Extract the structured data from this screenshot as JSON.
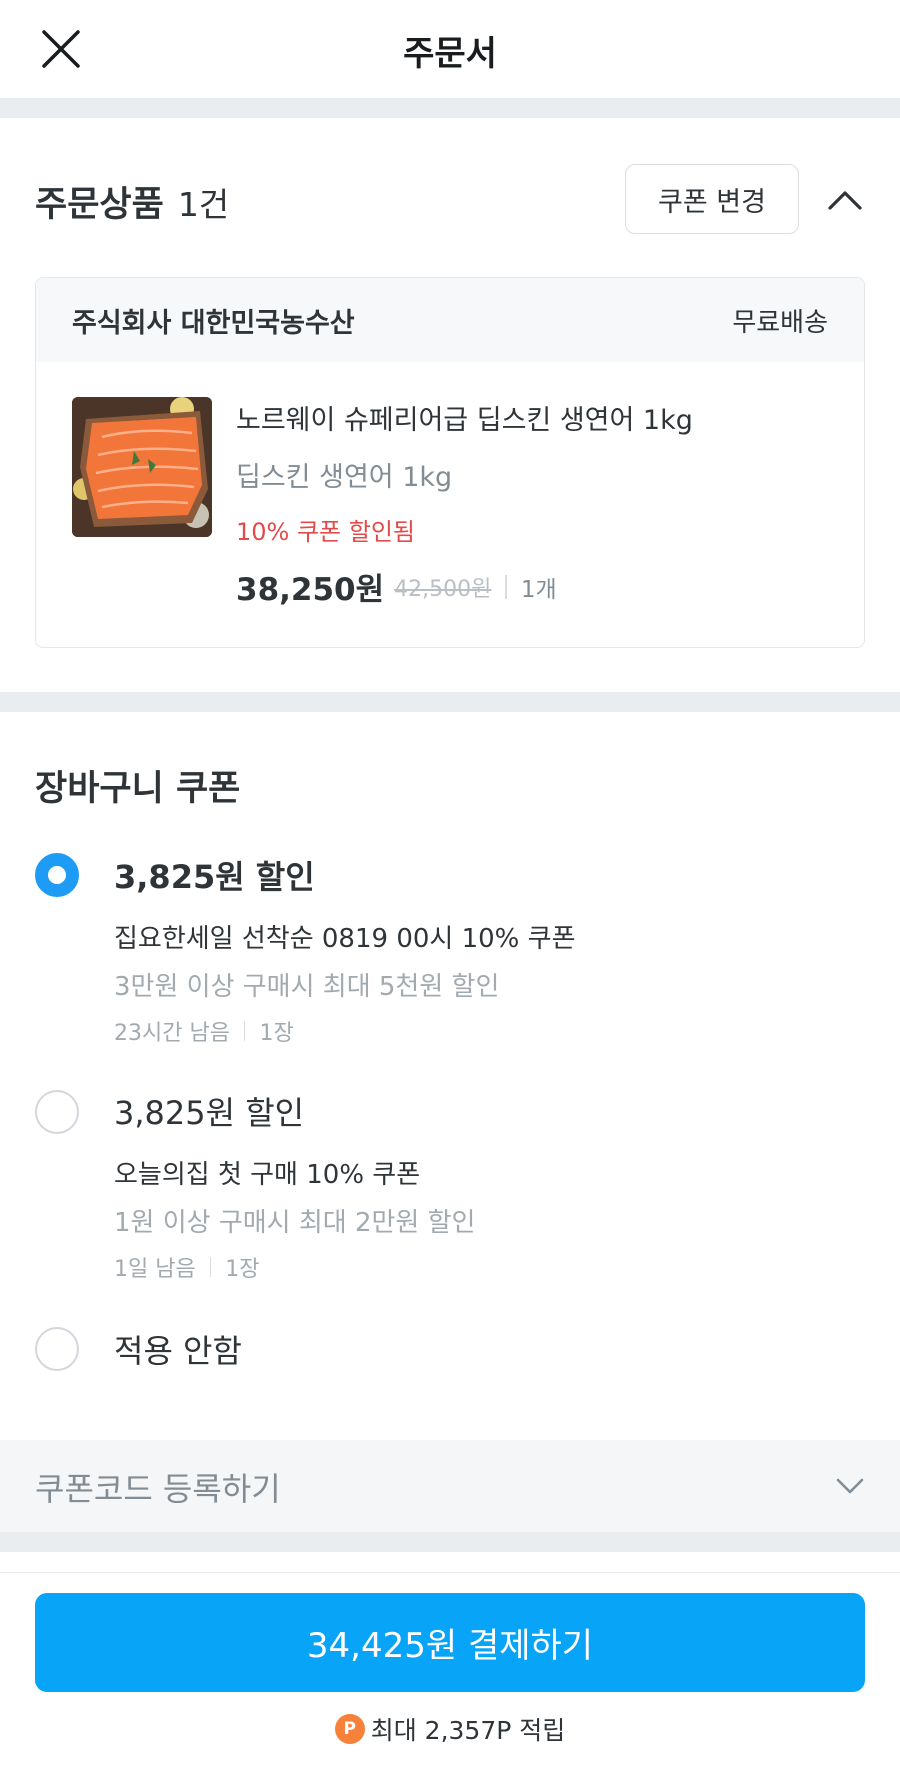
{
  "header": {
    "title": "주문서"
  },
  "order_products": {
    "title": "주문상품",
    "count": "1건",
    "coupon_change_label": "쿠폰 변경",
    "seller": "주식회사 대한민국농수산",
    "shipping": "무료배송",
    "product": {
      "name": "노르웨이 슈페리어급 딥스킨 생연어 1kg",
      "option": "딥스킨 생연어 1kg",
      "coupon_note": "10% 쿠폰 할인됨",
      "price": "38,250원",
      "original_price": "42,500원",
      "quantity": "1개"
    }
  },
  "cart_coupon": {
    "title": "장바구니 쿠폰",
    "coupons": [
      {
        "amount": "3,825원 할인",
        "name": "집요한세일 선착순 0819 00시 10% 쿠폰",
        "condition": "3만원 이상 구매시 최대 5천원 할인",
        "time_left": "23시간 남음",
        "quantity": "1장",
        "selected": true
      },
      {
        "amount": "3,825원 할인",
        "name": "오늘의집 첫 구매 10% 쿠폰",
        "condition": "1원 이상 구매시 최대 2만원 할인",
        "time_left": "1일 남음",
        "quantity": "1장",
        "selected": false
      }
    ],
    "no_apply_label": "적용 안함"
  },
  "coupon_code": {
    "label": "쿠폰코드 등록하기"
  },
  "footer": {
    "pay_label": "34,425원 결제하기",
    "points_icon": "P",
    "points_text": "최대 2,357P 적립"
  },
  "colors": {
    "accent": "#08a4f7",
    "radio_selected": "#1e9cf5",
    "discount_red": "#e34b4b",
    "points_orange": "#f7813b"
  }
}
